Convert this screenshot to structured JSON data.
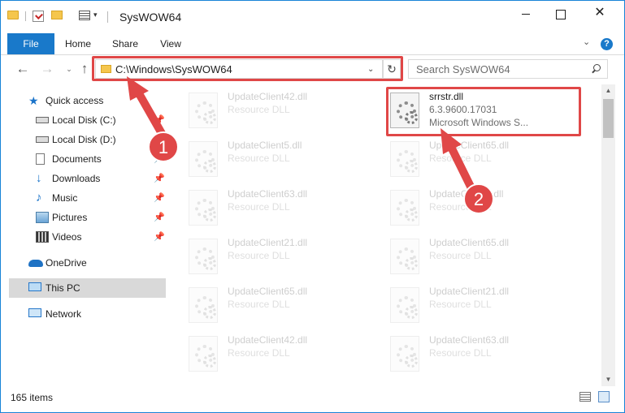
{
  "window": {
    "title": "SysWOW64",
    "dropdown_glyph": "▾",
    "min_glyph": "",
    "max_glyph": "",
    "close_glyph": "✕"
  },
  "ribbon": {
    "tabs": [
      {
        "label": "File",
        "active": true
      },
      {
        "label": "Home"
      },
      {
        "label": "Share"
      },
      {
        "label": "View"
      }
    ],
    "expand_glyph": "⌄",
    "help_glyph": "?"
  },
  "navigation": {
    "back_glyph": "←",
    "forward_glyph": "→",
    "recent_glyph": "⌄",
    "up_glyph": "↑",
    "address": "C:\\Windows\\SysWOW64",
    "address_dropdown_glyph": "⌄",
    "refresh_glyph": "↻",
    "search_placeholder": "Search SysWOW64"
  },
  "sidebar": {
    "items": [
      {
        "label": "Quick access",
        "icon": "star-icon",
        "pinned": false
      },
      {
        "label": "Local Disk (C:)",
        "icon": "drive-icon",
        "pinned": true
      },
      {
        "label": "Local Disk (D:)",
        "icon": "drive-icon",
        "pinned": false
      },
      {
        "label": "Documents",
        "icon": "documents-icon",
        "pinned": true
      },
      {
        "label": "Downloads",
        "icon": "download-icon",
        "pinned": true
      },
      {
        "label": "Music",
        "icon": "music-icon",
        "pinned": true
      },
      {
        "label": "Pictures",
        "icon": "pictures-icon",
        "pinned": true
      },
      {
        "label": "Videos",
        "icon": "videos-icon",
        "pinned": true
      },
      {
        "label": "OneDrive",
        "icon": "onedrive-icon",
        "pinned": false
      },
      {
        "label": "This PC",
        "icon": "pc-icon",
        "pinned": false,
        "selected": true
      },
      {
        "label": "Network",
        "icon": "network-icon",
        "pinned": false
      }
    ],
    "pin_glyph": "📌"
  },
  "files": {
    "left": [
      {
        "name": "UpdateClient42.dll",
        "type": "Resource DLL"
      },
      {
        "name": "UpdateClient5.dll",
        "type": "Resource DLL"
      },
      {
        "name": "UpdateClient63.dll",
        "type": "Resource DLL"
      },
      {
        "name": "UpdateClient21.dll",
        "type": "Resource DLL"
      },
      {
        "name": "UpdateClient65.dll",
        "type": "Resource DLL"
      },
      {
        "name": "UpdateClient42.dll",
        "type": "Resource DLL"
      }
    ],
    "right": [
      {
        "name": "srrstr.dll",
        "type": "6.3.9600.17031",
        "extra": "Microsoft Windows S...",
        "selected": true
      },
      {
        "name": "UpdateClient65.dll",
        "type": "Resource DLL"
      },
      {
        "name": "UpdateClient5.dll",
        "type": "Resource DLL"
      },
      {
        "name": "UpdateClient65.dll",
        "type": "Resource DLL"
      },
      {
        "name": "UpdateClient21.dll",
        "type": "Resource DLL"
      },
      {
        "name": "UpdateClient63.dll",
        "type": "Resource DLL"
      }
    ]
  },
  "scrollbar": {
    "up_glyph": "▲",
    "down_glyph": "▼"
  },
  "status": {
    "item_count": "165 items"
  },
  "annotations": [
    {
      "number": "1"
    },
    {
      "number": "2"
    }
  ],
  "colors": {
    "accent": "#1979ca",
    "highlight": "#e04747",
    "selected_nav": "#d9d9d9"
  }
}
